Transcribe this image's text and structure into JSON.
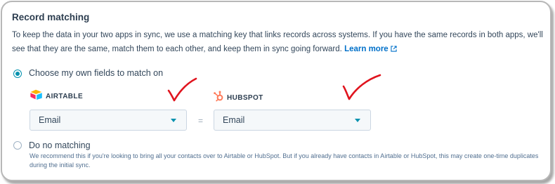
{
  "section": {
    "title": "Record matching",
    "description": "To keep the data in your two apps in sync, we use a matching key that links records across systems. If you have the same records in both apps, we'll see that they are the same, match them to each other, and keep them in sync going forward.",
    "learn_more": "Learn more"
  },
  "options": {
    "own_fields": {
      "label": "Choose my own fields to match on",
      "selected": true
    },
    "no_matching": {
      "label": "Do no matching",
      "selected": false,
      "help": "We recommend this if you're looking to bring all your contacts over to Airtable or HubSpot. But if you already have contacts in Airtable or HubSpot, this may create one-time duplicates during the initial sync."
    }
  },
  "apps": {
    "left": {
      "name": "AIRTABLE",
      "icon": "airtable-logo-icon",
      "field_value": "Email"
    },
    "right": {
      "name": "HUBSPOT",
      "icon": "hubspot-logo-icon",
      "field_value": "Email"
    },
    "separator": "="
  },
  "colors": {
    "accent": "#0091ae",
    "link": "#0070c9",
    "hubspot": "#ff7a59",
    "annotation": "#e0141e"
  }
}
